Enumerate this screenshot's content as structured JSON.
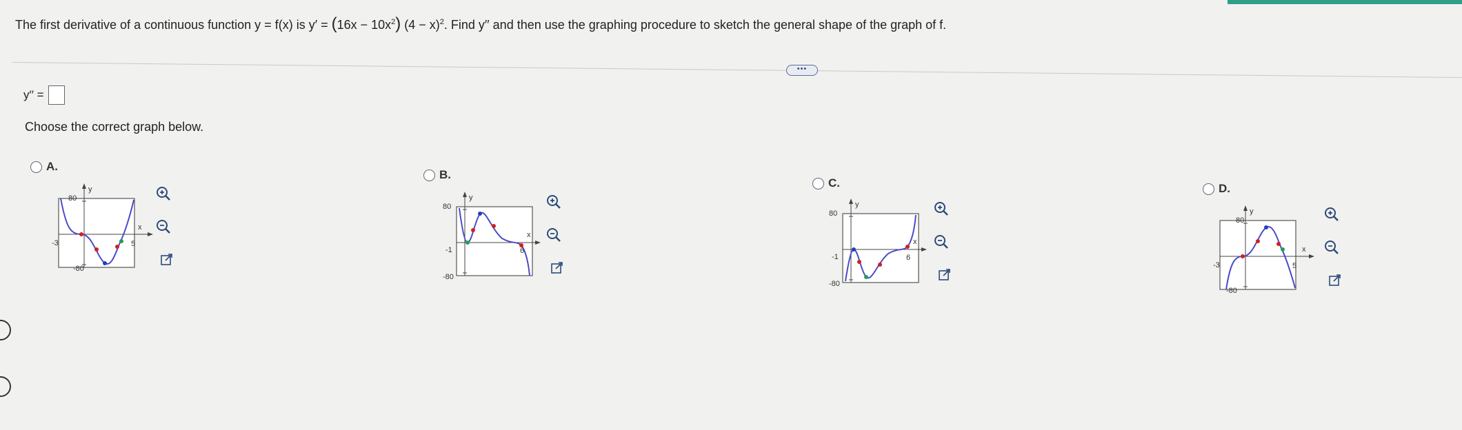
{
  "question": {
    "p1": "The first derivative of a continuous function y = f(x) is y′ = ",
    "f1": "16x − 10x",
    "e1": "2",
    "f2": " (4 − x)",
    "e2": "2",
    "p2": ". Find y′′ and then use the graphing procedure to sketch the general shape of the graph of f."
  },
  "more_label": "•••",
  "answer": {
    "label": "y′′ =",
    "value": ""
  },
  "instruction": "Choose the correct graph below.",
  "options": [
    {
      "letter": "A.",
      "y_max": "80",
      "y_min": "-80",
      "x_min": "-3",
      "x_max": "5",
      "x_axis": "x",
      "y_axis": "y"
    },
    {
      "letter": "B.",
      "y_max": "80",
      "y_min": "-80",
      "x_min": "-1",
      "x_max": "6",
      "x_axis": "x",
      "y_axis": "y"
    },
    {
      "letter": "C.",
      "y_max": "80",
      "y_min": "-80",
      "x_min": "-1",
      "x_max": "6",
      "x_axis": "x",
      "y_axis": "y"
    },
    {
      "letter": "D.",
      "y_max": "80",
      "y_min": "-80",
      "x_min": "-3",
      "x_max": "5",
      "x_axis": "x",
      "y_axis": "y"
    }
  ],
  "icons": {
    "zoom_in": "zoom-in-icon",
    "zoom_out": "zoom-out-icon",
    "external": "external-link-icon"
  },
  "colors": {
    "curve": "#4a4ac8",
    "red_point": "#d02020",
    "green_point": "#20a050",
    "blue_point": "#2040c0",
    "accent": "#2e9e86"
  }
}
